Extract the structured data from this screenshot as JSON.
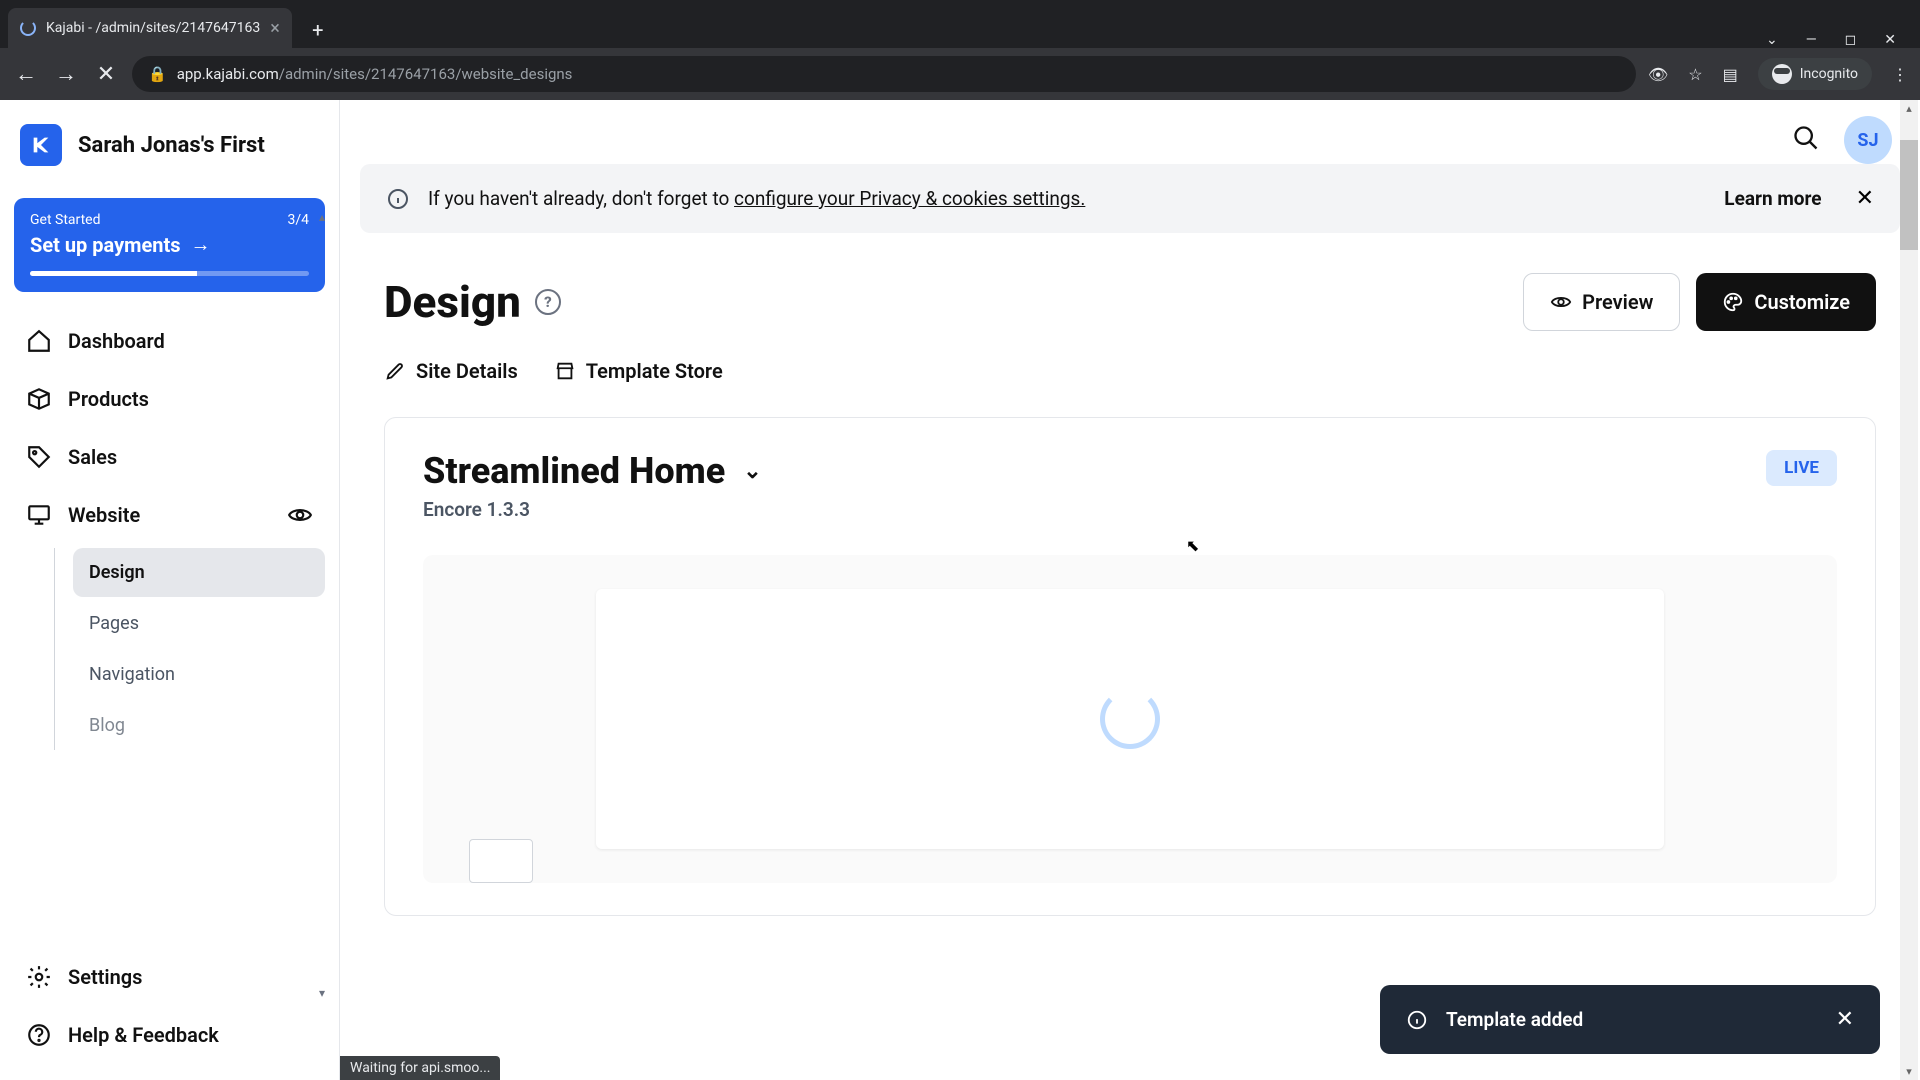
{
  "browser": {
    "tab_title": "Kajabi - /admin/sites/2147647163",
    "url_prefix": "app.kajabi.com",
    "url_path": "/admin/sites/2147647163/website_designs",
    "incognito_label": "Incognito",
    "status_text": "Waiting for api.smoo..."
  },
  "header": {
    "site_name": "Sarah Jonas's First",
    "avatar_initials": "SJ"
  },
  "get_started": {
    "title": "Get Started",
    "progress_text": "3/4",
    "action_label": "Set up payments"
  },
  "nav": {
    "dashboard": "Dashboard",
    "products": "Products",
    "sales": "Sales",
    "website": "Website",
    "settings": "Settings",
    "help": "Help & Feedback"
  },
  "subnav": {
    "design": "Design",
    "pages": "Pages",
    "navigation": "Navigation",
    "blog": "Blog"
  },
  "banner": {
    "text_prefix": "If you haven't already, don't forget to ",
    "link_text": "configure your Privacy & cookies settings.",
    "learn_more": "Learn more"
  },
  "page": {
    "title": "Design",
    "preview_btn": "Preview",
    "customize_btn": "Customize",
    "site_details": "Site Details",
    "template_store": "Template Store"
  },
  "theme": {
    "name": "Streamlined Home",
    "version": "Encore 1.3.3",
    "status": "LIVE"
  },
  "toast": {
    "message": "Template added"
  }
}
